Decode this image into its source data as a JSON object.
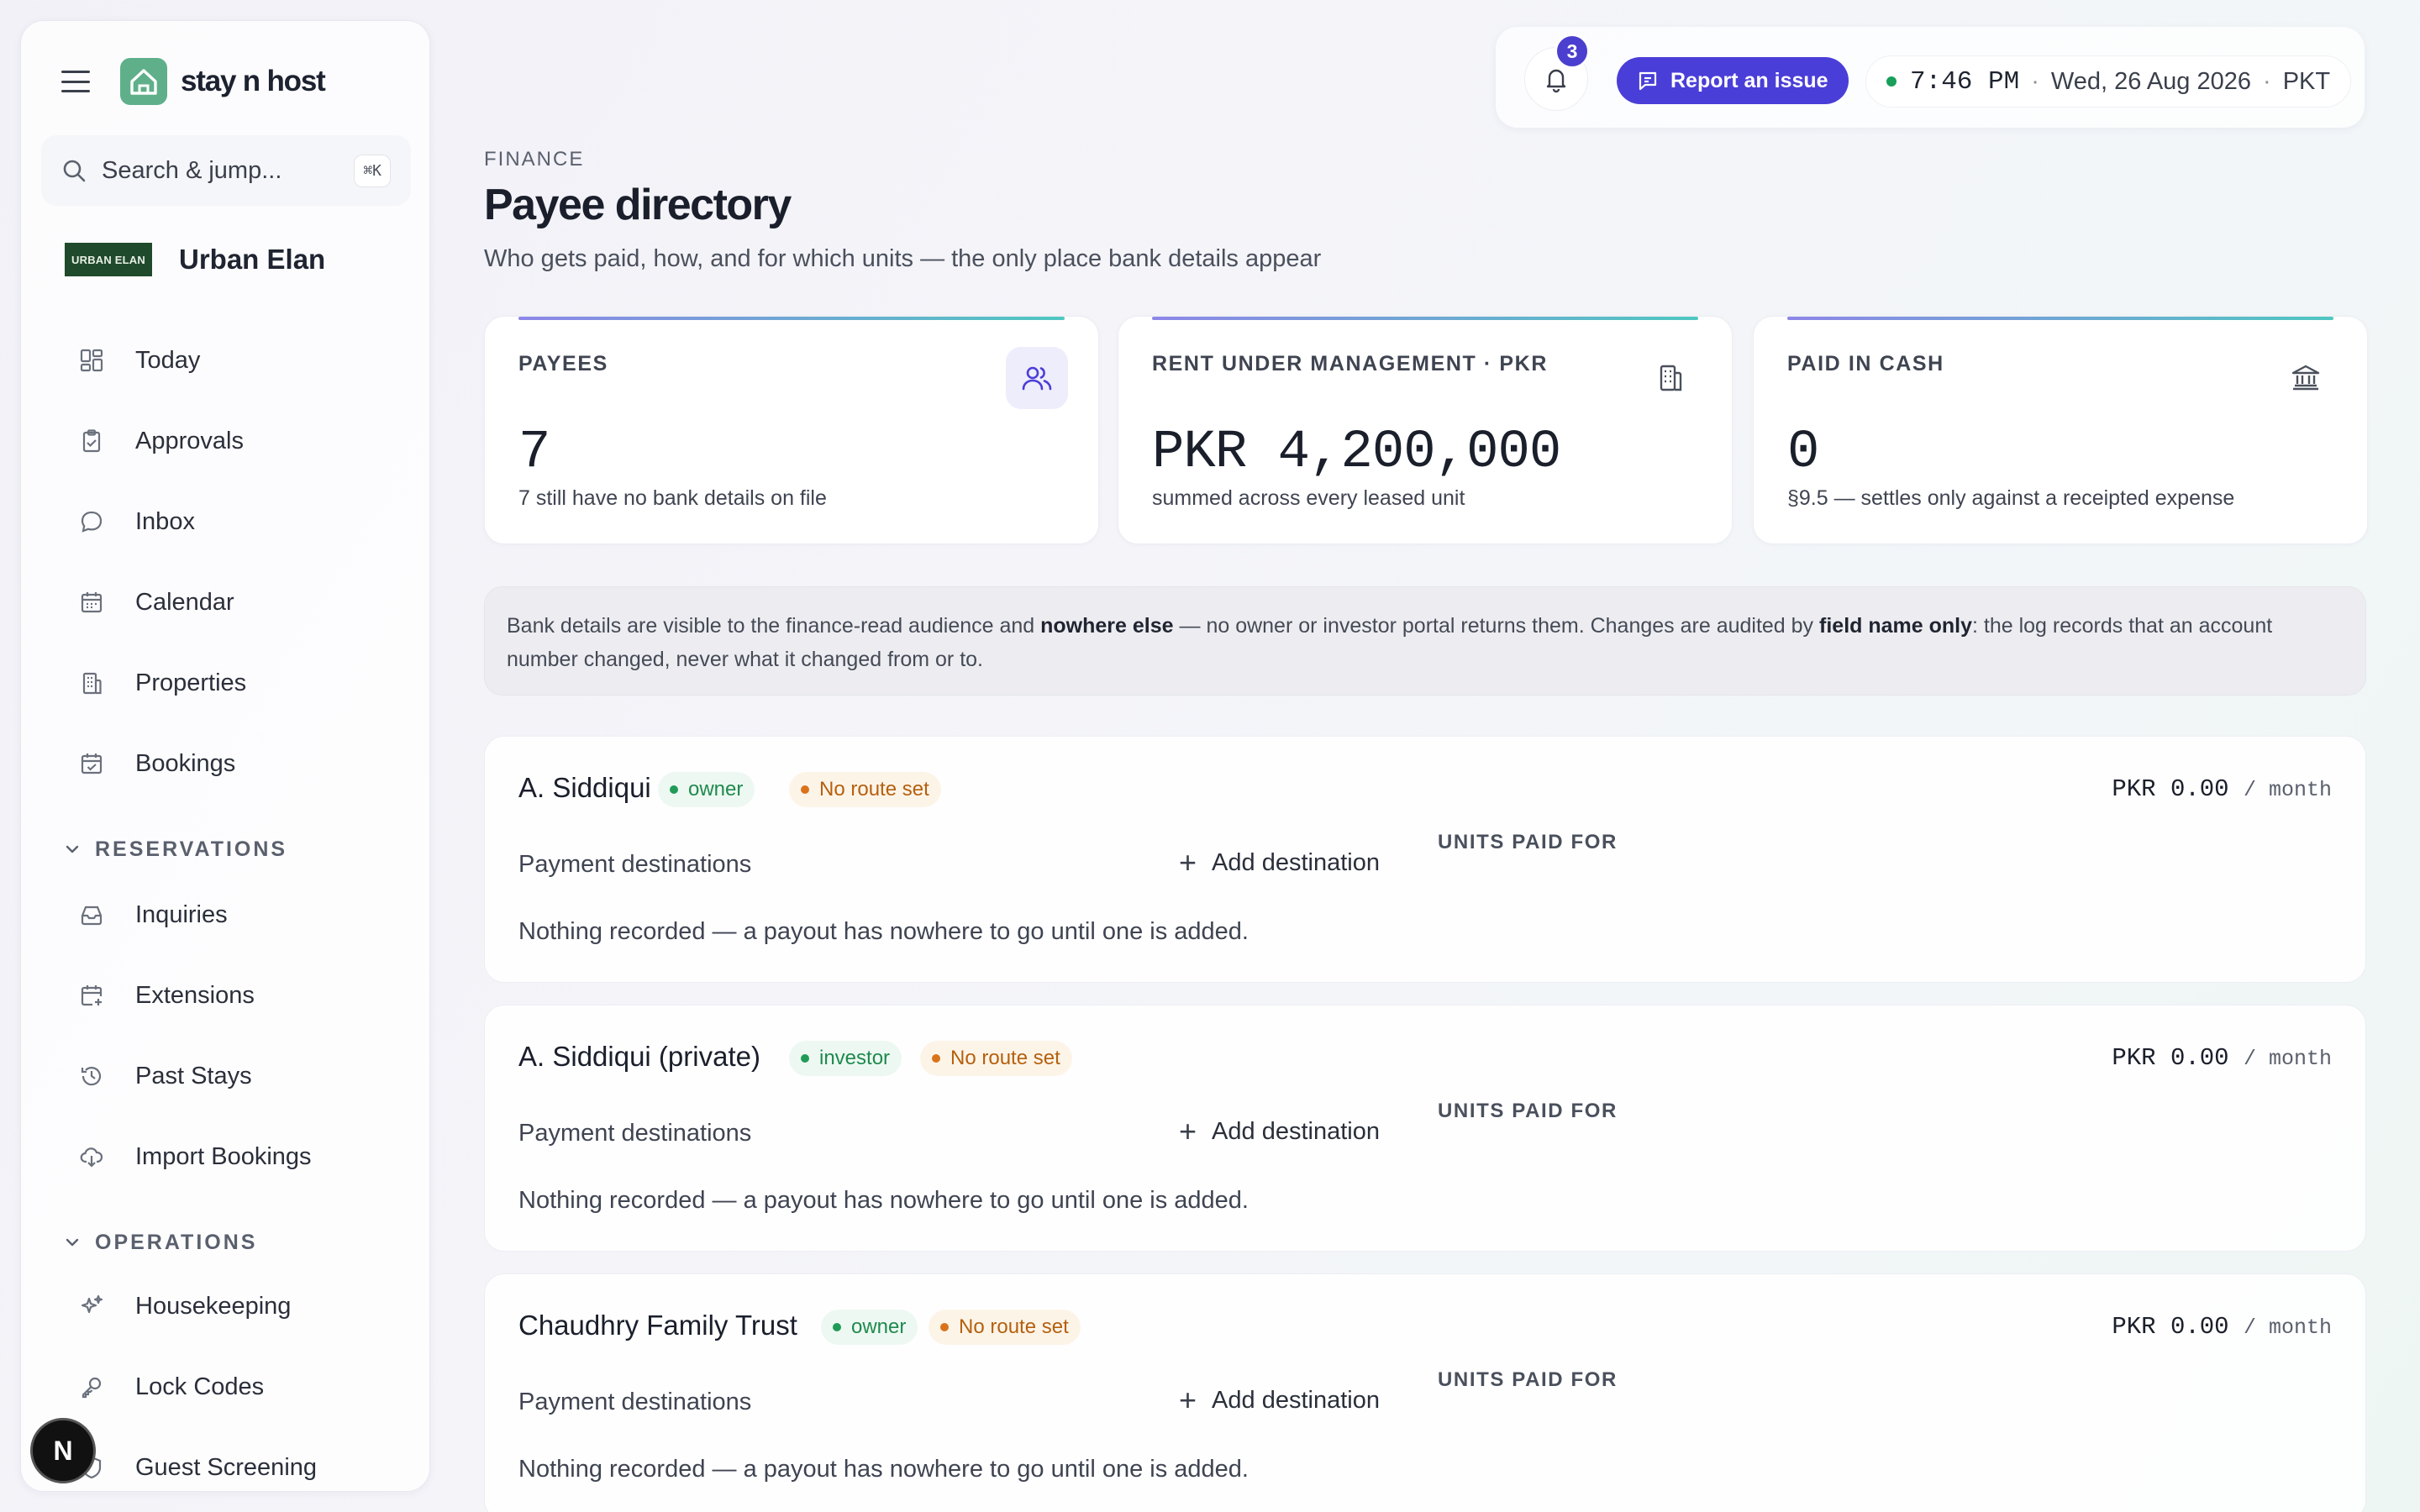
{
  "brand": {
    "name": "stay n host"
  },
  "search": {
    "placeholder": "Search & jump...",
    "shortcut": "⌘K"
  },
  "org": {
    "badge": "URBAN ELAN",
    "name": "Urban Elan"
  },
  "nav": {
    "main": [
      {
        "label": "Today",
        "icon": "dashboard-icon"
      },
      {
        "label": "Approvals",
        "icon": "clipboard-check-icon"
      },
      {
        "label": "Inbox",
        "icon": "chat-bubble-icon"
      },
      {
        "label": "Calendar",
        "icon": "calendar-icon"
      },
      {
        "label": "Properties",
        "icon": "building-icon"
      },
      {
        "label": "Bookings",
        "icon": "calendar-check-icon"
      }
    ],
    "reservations_label": "RESERVATIONS",
    "reservations": [
      {
        "label": "Inquiries",
        "icon": "inbox-tray-icon"
      },
      {
        "label": "Extensions",
        "icon": "calendar-plus-icon"
      },
      {
        "label": "Past Stays",
        "icon": "history-icon"
      },
      {
        "label": "Import Bookings",
        "icon": "cloud-download-icon"
      }
    ],
    "operations_label": "OPERATIONS",
    "operations": [
      {
        "label": "Housekeeping",
        "icon": "sparkle-icon"
      },
      {
        "label": "Lock Codes",
        "icon": "key-icon"
      },
      {
        "label": "Guest Screening",
        "icon": "shield-icon"
      }
    ]
  },
  "user_avatar": "N",
  "topbar": {
    "notifications": "3",
    "report_label": "Report an issue",
    "time": "7:46 PM",
    "date": "Wed, 26 Aug 2026",
    "timezone": "PKT",
    "separator": "·"
  },
  "header": {
    "eyebrow": "FINANCE",
    "title": "Payee directory",
    "subtitle": "Who gets paid, how, and for which units — the only place bank details appear"
  },
  "stats": [
    {
      "label": "PAYEES",
      "value": "7",
      "note": "7 still have no bank details on file",
      "icon": "people-icon"
    },
    {
      "label": "RENT UNDER MANAGEMENT · PKR",
      "value": "PKR 4,200,000",
      "note": "summed across every leased unit",
      "icon": "building-icon"
    },
    {
      "label": "PAID IN CASH",
      "value": "0",
      "note": "§9.5 — settles only against a receipted expense",
      "icon": "bank-icon"
    }
  ],
  "notice": {
    "p1": "Bank details are visible to the finance-read audience and ",
    "b1": "nowhere else",
    "p2": " — no owner or investor portal returns them. Changes are audited by ",
    "b2": "field name only",
    "p3": ": the log records that an account number changed, never what it changed from or to."
  },
  "payee_labels": {
    "destinations": "Payment destinations",
    "add_destination": "Add destination",
    "units_paid_for": "UNITS PAID FOR",
    "empty": "Nothing recorded — a payout has nowhere to go until one is added.",
    "per_month": "/ month",
    "no_route": "No route set"
  },
  "payees": [
    {
      "name": "A. Siddiqui",
      "role": "owner",
      "amount": "PKR 0.00"
    },
    {
      "name": "A. Siddiqui (private)",
      "role": "investor",
      "amount": "PKR 0.00"
    },
    {
      "name": "Chaudhry Family Trust",
      "role": "owner",
      "amount": "PKR 0.00"
    }
  ],
  "colors": {
    "accent": "#4a3ed8",
    "brand": "#5fb08a",
    "status_ok": "#1f9b57",
    "status_warn": "#d9731a"
  }
}
